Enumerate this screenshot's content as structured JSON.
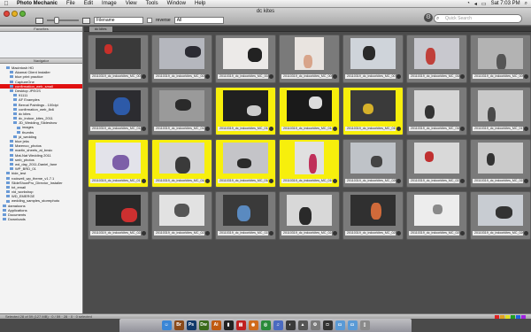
{
  "menubar": {
    "apple_icon": "apple-logo",
    "app_name": "Photo Mechanic",
    "menus": [
      "File",
      "Edit",
      "Image",
      "View",
      "Tools",
      "Window",
      "Help"
    ],
    "clock": "Sat 7:03 PM"
  },
  "window": {
    "title": "dc kites"
  },
  "toolbar": {
    "sort_field": "Filename",
    "reverse_label": "reverse",
    "filter_value": "All",
    "search_placeholder": "Quick Search"
  },
  "sidebar": {
    "favorites_header": "Favorites",
    "navigator_header": "Navigator",
    "items": [
      {
        "label": "Macintosh HD",
        "indent": 1
      },
      {
        "label": "Akamai Client Installer",
        "indent": 2
      },
      {
        "label": "blue print practice",
        "indent": 2
      },
      {
        "label": "CaptureOne",
        "indent": 2
      },
      {
        "label": "confirmation_web_small",
        "indent": 2,
        "selected": true
      },
      {
        "label": "Desktop JPEGS",
        "indent": 2
      },
      {
        "label": "91111",
        "indent": 3
      },
      {
        "label": "AF Examples",
        "indent": 3
      },
      {
        "label": "Bernal Paintings - 100dpi",
        "indent": 3
      },
      {
        "label": "confirmation_web_8x6",
        "indent": 3
      },
      {
        "label": "dc kites",
        "indent": 3
      },
      {
        "label": "dc_indoor_kites_2011",
        "indent": 3
      },
      {
        "label": "JD_Wedding_Slideshow",
        "indent": 3
      },
      {
        "label": "images",
        "indent": 4
      },
      {
        "label": "thumbs",
        "indent": 4
      },
      {
        "label": "jd_wedding",
        "indent": 3
      },
      {
        "label": "blue jeks",
        "indent": 2
      },
      {
        "label": "Marenco_photos",
        "indent": 2
      },
      {
        "label": "martin_sheets_at_bnsic",
        "indent": 2
      },
      {
        "label": "Mat-Nat Wedding 2011",
        "indent": 2
      },
      {
        "label": "smb_photos",
        "indent": 2
      },
      {
        "label": "wd_day_2011-Daniel_fane",
        "indent": 2
      },
      {
        "label": "WP_BRD_01",
        "indent": 2
      },
      {
        "label": "hide_test",
        "indent": 1
      },
      {
        "label": "rockwell_wp_theme_v1.7.1",
        "indent": 1
      },
      {
        "label": "SlideShowPro_Director_Installer",
        "indent": 1
      },
      {
        "label": "txt_email",
        "indent": 1
      },
      {
        "label": "vid_workshop",
        "indent": 1
      },
      {
        "label": "WD_EMERGE",
        "indent": 1
      },
      {
        "label": "wedding_samples_stormphoto",
        "indent": 1
      },
      {
        "label": "damaloons",
        "indent": 0
      },
      {
        "label": "Applications",
        "indent": 0
      },
      {
        "label": "Documents",
        "indent": 0
      },
      {
        "label": "Downloads",
        "indent": 0
      }
    ]
  },
  "main": {
    "tab_label": "dc kites",
    "thumbnails": [
      {
        "caption": "20110319_dc_indoorkites_MC_0014.JPG",
        "highlight": false,
        "bg": "#3a3a3a",
        "fg": "#c7302a"
      },
      {
        "caption": "20110319_dc_indoorkites_MC_0031.JPG",
        "highlight": false,
        "bg": "#b5b7be",
        "fg": "#2b2b33"
      },
      {
        "caption": "20110319_dc_indoorkites_MC_0048.JPG",
        "highlight": false,
        "bg": "#eceae8",
        "fg": "#222222"
      },
      {
        "caption": "20110319_dc_indoorkites_MC_0059.JPG",
        "highlight": false,
        "bg": "#e9e4e0",
        "fg": "#d8a48a",
        "portrait": true
      },
      {
        "caption": "20110319_dc_indoorkites_MC_0073.JPG",
        "highlight": false,
        "bg": "#cfd4da",
        "fg": "#2a2a2a"
      },
      {
        "caption": "20110319_dc_indoorkites_MC_0082.JPG",
        "highlight": false,
        "bg": "#c8c8ce",
        "fg": "#c0403a"
      },
      {
        "caption": "20110319_dc_indoorkites_MC_0094.JPG",
        "highlight": false,
        "bg": "#b3b3b3",
        "fg": "#555555"
      },
      {
        "caption": "20110319_dc_indoorkites_MC_0121.JPG",
        "highlight": false,
        "bg": "#2c2c30",
        "fg": "#2d5aa8"
      },
      {
        "caption": "20110319_dc_indoorkites_MC_0129.JPG",
        "highlight": false,
        "bg": "#9a9a9a",
        "fg": "#2a2a2a"
      },
      {
        "caption": "20110319_dc_indoorkites_MC_0136.JPG",
        "highlight": true,
        "bg": "#202020",
        "fg": "#cccccc"
      },
      {
        "caption": "20110319_dc_indoorkites_MC_0147.JPG",
        "highlight": true,
        "bg": "#1a1a1a",
        "fg": "#dddddd"
      },
      {
        "caption": "20110319_dc_indoorkites_MC_0155.JPG",
        "highlight": true,
        "bg": "#3a3a3a",
        "fg": "#d6b12a"
      },
      {
        "caption": "20110319_dc_indoorkites_MC_0168.JPG",
        "highlight": false,
        "bg": "#d5d5d5",
        "fg": "#333333"
      },
      {
        "caption": "20110319_dc_indoorkites_MC_0172.JPG",
        "highlight": false,
        "bg": "#c9c9c9",
        "fg": "#4a4a4a"
      },
      {
        "caption": "20110319_dc_indoorkites_MC_0178.JPG",
        "highlight": true,
        "bg": "#e3e3ea",
        "fg": "#7d5fa8"
      },
      {
        "caption": "20110319_dc_indoorkites_MC_0182.JPG",
        "highlight": true,
        "bg": "#d2d2d4",
        "fg": "#3a3a3a"
      },
      {
        "caption": "20110319_dc_indoorkites_MC_0186.JPG",
        "highlight": true,
        "bg": "#c4c4c8",
        "fg": "#2a2a2a"
      },
      {
        "caption": "20110319_dc_indoorkites_MC_0194.JPG",
        "highlight": true,
        "bg": "#e0e0e0",
        "fg": "#c0305a",
        "portrait": true
      },
      {
        "caption": "20110319_dc_indoorkites_MC_0203.JPG",
        "highlight": false,
        "bg": "#bfc3c8",
        "fg": "#444444"
      },
      {
        "caption": "20110319_dc_indoorkites_MC_0211.JPG",
        "highlight": false,
        "bg": "#d9d9d9",
        "fg": "#c03030"
      },
      {
        "caption": "20110319_dc_indoorkites_MC_0219.JPG",
        "highlight": false,
        "bg": "#cacaca",
        "fg": "#333333"
      },
      {
        "caption": "20110319_dc_indoorkites_MC_0226.JPG",
        "highlight": false,
        "bg": "#2a2a2a",
        "fg": "#cc3030"
      },
      {
        "caption": "20110319_dc_indoorkites_MC_0230.JPG",
        "highlight": false,
        "bg": "#e2e2e2",
        "fg": "#555555"
      },
      {
        "caption": "20110319_dc_indoorkites_MC_0237.JPG",
        "highlight": false,
        "bg": "#3a3a3a",
        "fg": "#5a8ac0"
      },
      {
        "caption": "20110319_dc_indoorkites_MC_0245.JPG",
        "highlight": false,
        "bg": "#d8d8d8",
        "fg": "#2a2a2a"
      },
      {
        "caption": "20110319_dc_indoorkites_MC_0251.JPG",
        "highlight": false,
        "bg": "#303030",
        "fg": "#d06a3a"
      },
      {
        "caption": "20110319_dc_indoorkites_MC_0258.JPG",
        "highlight": false,
        "bg": "#ededed",
        "fg": "#8a8a8a"
      },
      {
        "caption": "20110319_dc_indoorkites_MC_0264.JPG",
        "highlight": false,
        "bg": "#c8ccd2",
        "fg": "#333333"
      }
    ]
  },
  "statusbar": {
    "text": "Selected 28 of 59 (127 MB) · 0 / 59 · 28 · 0 · 0 selected"
  },
  "dock": {
    "icons": [
      {
        "name": "finder-icon",
        "color": "#3a86d6",
        "glyph": "☺"
      },
      {
        "name": "bridge-icon",
        "color": "#8a4a1a",
        "glyph": "Br"
      },
      {
        "name": "photoshop-icon",
        "color": "#123a6a",
        "glyph": "Ps"
      },
      {
        "name": "dreamweaver-icon",
        "color": "#3a6a1a",
        "glyph": "Dw"
      },
      {
        "name": "illustrator-icon",
        "color": "#c05a10",
        "glyph": "Ai"
      },
      {
        "name": "terminal-icon",
        "color": "#222222",
        "glyph": "▮"
      },
      {
        "name": "ical-icon",
        "color": "#c02020",
        "glyph": "▤"
      },
      {
        "name": "firefox-icon",
        "color": "#d06a1a",
        "glyph": "◉"
      },
      {
        "name": "chrome-icon",
        "color": "#2a8a3a",
        "glyph": "◎"
      },
      {
        "name": "itunes-icon",
        "color": "#4a6ac0",
        "glyph": "♫"
      },
      {
        "name": "photo-mechanic-icon",
        "color": "#3a3a3a",
        "glyph": "◐"
      },
      {
        "name": "activity-monitor-icon",
        "color": "#555555",
        "glyph": "▲"
      },
      {
        "name": "system-prefs-icon",
        "color": "#7a7a7a",
        "glyph": "⚙"
      },
      {
        "name": "camera-icon",
        "color": "#333333",
        "glyph": "◘"
      },
      {
        "name": "applications-folder-icon",
        "color": "#5a9ad6",
        "glyph": "▭"
      },
      {
        "name": "documents-folder-icon",
        "color": "#5a9ad6",
        "glyph": "▭"
      },
      {
        "name": "trash-icon",
        "color": "#8a8a8a",
        "glyph": "▯"
      }
    ]
  }
}
